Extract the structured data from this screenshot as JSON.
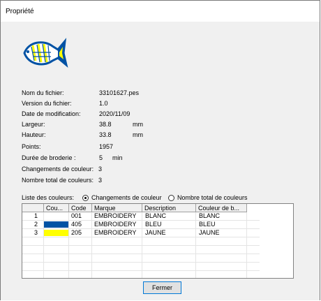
{
  "window": {
    "title": "Propriété"
  },
  "properties": [
    {
      "label": "Nom du fichier:",
      "value": "33101627.pes",
      "unit": ""
    },
    {
      "label": "Version du fichier:",
      "value": "1.0",
      "unit": ""
    },
    {
      "label": "Date de modification:",
      "value": "2020/11/09",
      "unit": ""
    },
    {
      "label": "Largeur:",
      "value": "38.8",
      "unit": "mm"
    },
    {
      "label": "Hauteur:",
      "value": "33.8",
      "unit": "mm"
    },
    {
      "label": "Points:",
      "value": "1957",
      "unit": ""
    },
    {
      "label": "Durée de broderie :",
      "value": "5",
      "unit": "min"
    },
    {
      "label": "Changements de couleur:",
      "value": "3",
      "unit": ""
    },
    {
      "label": "Nombre total de couleurs:",
      "value": "3",
      "unit": ""
    }
  ],
  "color_list": {
    "label": "Liste des couleurs:",
    "options": [
      {
        "label": "Changements de couleur",
        "selected": true
      },
      {
        "label": "Nombre total de couleurs",
        "selected": false
      }
    ],
    "columns": [
      "",
      "Cou...",
      "Code",
      "Marque",
      "Description",
      "Couleur de b..."
    ],
    "rows": [
      {
        "num": "1",
        "swatch": "#ffffff",
        "code": "001",
        "brand": "EMBROIDERY",
        "description": "BLANC",
        "thread_color": "BLANC"
      },
      {
        "num": "2",
        "swatch": "#0052a4",
        "code": "405",
        "brand": "EMBROIDERY",
        "description": "BLEU",
        "thread_color": "BLEU"
      },
      {
        "num": "3",
        "swatch": "#ffff00",
        "code": "205",
        "brand": "EMBROIDERY",
        "description": "JAUNE",
        "thread_color": "JAUNE"
      }
    ]
  },
  "buttons": {
    "close": "Fermer"
  }
}
